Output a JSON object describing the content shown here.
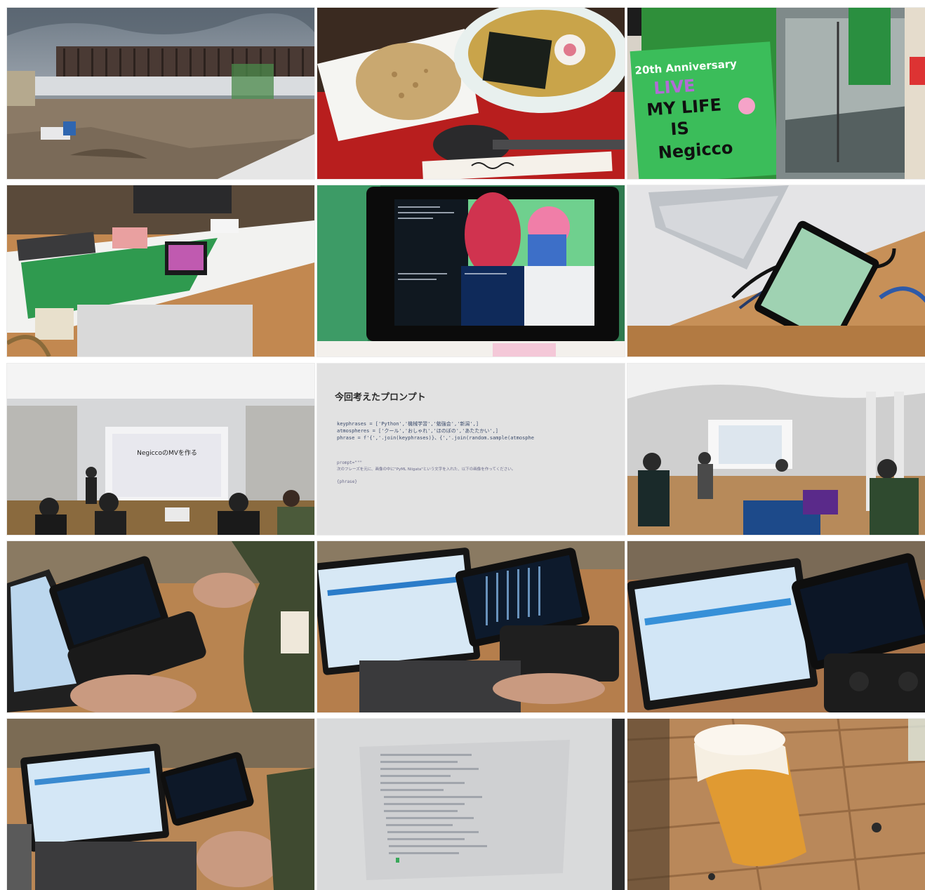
{
  "gallery": {
    "tiles": [
      {
        "subject": "station-construction-photo"
      },
      {
        "subject": "ramen-fried-rice-photo"
      },
      {
        "subject": "negicco-poster-photo",
        "poster_text": [
          "20th Anniversary",
          "LIVE",
          "MY LIFE",
          "IS",
          "Negicco"
        ]
      },
      {
        "subject": "exhibit-table-photo"
      },
      {
        "subject": "tablet-anime-screen-photo"
      },
      {
        "subject": "mini-pc-and-display-photo"
      },
      {
        "subject": "stage-presentation-photo",
        "slide_text": "NegiccoのMVを作る"
      },
      {
        "subject": "prompt-slide-photo",
        "slide_title": "今回考えたプロンプト",
        "code_lines": [
          "keyphrases = ['Python','機械学習','勉強会','新潟',]",
          "atmospheres = ['クール','おしゃれ','ほのぼの','あたたかい',]",
          "phrase = f'{','.join(keyphrases)}、{','.join(random.sample(atmosphe"
        ],
        "prompt_label": "prompt=\"\"\"",
        "prompt_text": "次のフレーズを元に、画像の中に\"PyML Niigata\"という文字を入れた、以下の画像を作ってください。",
        "prompt_end": "{phrase}"
      },
      {
        "subject": "event-hall-photo"
      },
      {
        "subject": "handheld-pc-photo"
      },
      {
        "subject": "laptop-and-handheld-photo"
      },
      {
        "subject": "laptop-and-handheld-closeup-photo"
      },
      {
        "subject": "laptop-on-lap-photo"
      },
      {
        "subject": "projected-terminal-photo"
      },
      {
        "subject": "beer-glass-photo"
      }
    ]
  },
  "colors": {
    "wood": "#c68b52",
    "screen_blue": "#cfe4f6",
    "terminal": "#0d1a2c",
    "poster_green": "#38c45c",
    "beer": "#e09a32"
  }
}
